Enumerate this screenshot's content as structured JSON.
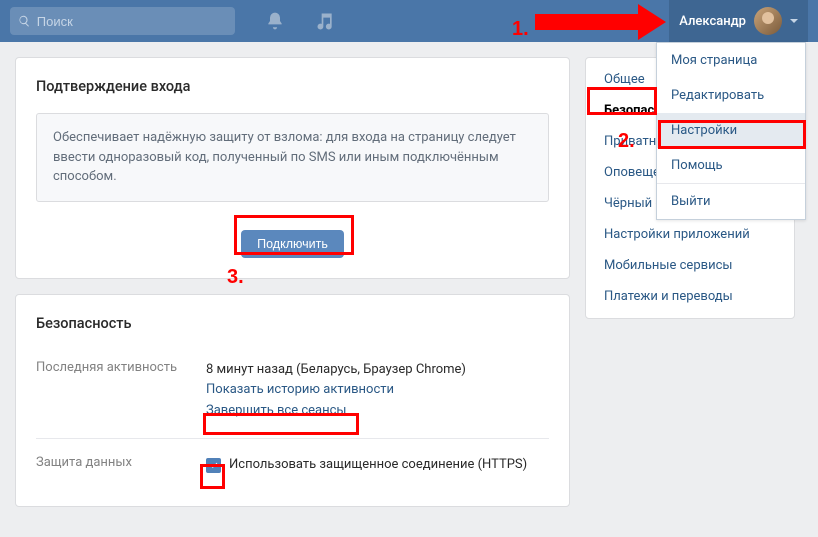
{
  "header": {
    "search_placeholder": "Поиск",
    "user_name": "Александр"
  },
  "dropdown": {
    "items": [
      "Моя страница",
      "Редактировать",
      "Настройки",
      "Помощь",
      "Выйти"
    ]
  },
  "panel1": {
    "title": "Подтверждение входа",
    "info": "Обеспечивает надёжную защиту от взлома: для входа на страницу следует ввести одноразовый код, полученный по SMS или иным подключённым способом.",
    "btn": "Подключить"
  },
  "panel2": {
    "title": "Безопасность",
    "activity_label": "Последняя активность",
    "activity_value": "8 минут назад (Беларусь, Браузер Chrome)",
    "show_history": "Показать историю активности",
    "end_sessions": "Завершить все сеансы",
    "data_protection_label": "Защита данных",
    "https_label": "Использовать защищенное соединение (HTTPS)"
  },
  "sidebar": {
    "items": [
      "Общее",
      "Безопасность",
      "Приватность",
      "Оповещения",
      "Чёрный список",
      "Настройки приложений",
      "Мобильные сервисы",
      "Платежи и переводы"
    ]
  },
  "annotations": {
    "n1": "1.",
    "n2": "2.",
    "n3": "3."
  }
}
